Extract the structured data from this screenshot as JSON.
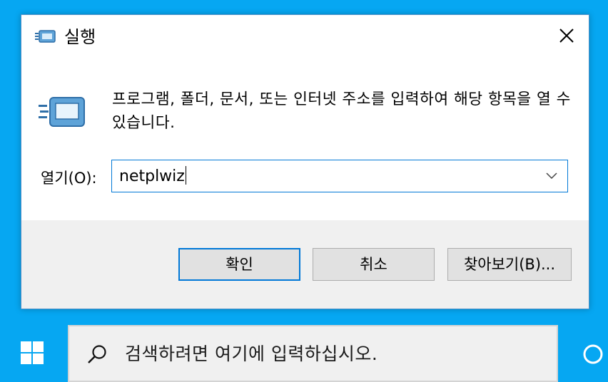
{
  "dialog": {
    "title": "실행",
    "description": "프로그램, 폴더, 문서, 또는 인터넷 주소를 입력하여 해당 항목을 열 수 있습니다.",
    "open_label": "열기(O):",
    "open_value": "netplwiz",
    "buttons": {
      "ok": "확인",
      "cancel": "취소",
      "browse": "찾아보기(B)..."
    }
  },
  "taskbar": {
    "search_placeholder": "검색하려면 여기에 입력하십시오."
  },
  "colors": {
    "desktop": "#06a7f2",
    "accent": "#0078d7",
    "button_bar": "#f0f0f0"
  },
  "icons": [
    "run-icon",
    "close-icon",
    "chevron-down-icon",
    "windows-start-icon",
    "search-icon",
    "cortana-icon"
  ]
}
